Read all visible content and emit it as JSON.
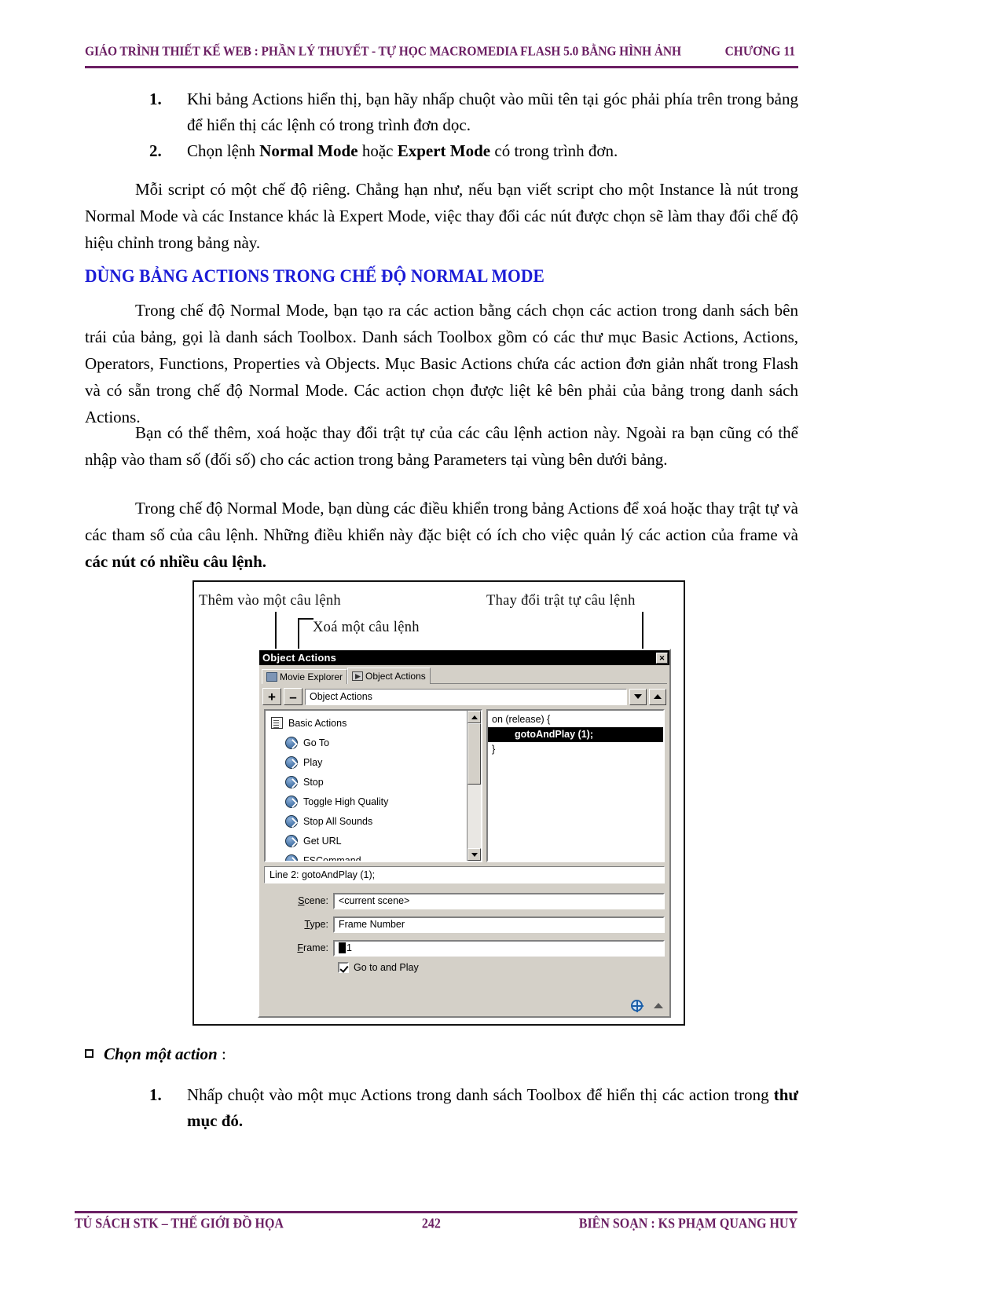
{
  "header": {
    "title": "GIÁO TRÌNH THIẾT KẾ WEB : PHẦN LÝ THUYẾT - TỰ HỌC MACROMEDIA FLASH 5.0 BẰNG HÌNH ẢNH",
    "chapter": "CHƯƠNG 11"
  },
  "list_top": [
    {
      "num": "1.",
      "text": "Khi bảng Actions hiển thị, bạn hãy nhấp chuột vào mũi tên tại góc phải phía trên trong bảng để hiển thị các lệnh có trong trình đơn dọc."
    },
    {
      "num": "2.",
      "text_1": "Chọn lệnh ",
      "bold_1": "Normal Mode",
      "text_2": " hoặc ",
      "bold_2": "Expert Mode",
      "text_3": " có trong trình đơn."
    }
  ],
  "paragraphs": {
    "p1": "Mỗi script có một chế độ riêng. Chẳng hạn như, nếu bạn viết script cho một Instance là nút trong Normal Mode và các Instance khác là Expert Mode, việc thay đổi các nút được chọn sẽ làm thay đổi chế độ hiệu chỉnh trong bảng này.",
    "p2": "Trong chế độ Normal Mode, bạn tạo ra các action bằng cách chọn các action trong danh sách bên trái của bảng, gọi là danh sách Toolbox. Danh sách Toolbox gồm có các thư mục Basic Actions, Actions, Operators, Functions, Properties và Objects. Mục Basic Actions chứa các action đơn giản nhất trong Flash và có sẵn trong chế độ Normal Mode. Các action chọn được liệt kê bên phải của bảng trong danh sách Actions.",
    "p3": "Bạn có thể thêm, xoá hoặc thay đổi trật tự của các câu lệnh action này. Ngoài ra bạn cũng có thể nhập vào tham số (đối số) cho các action trong bảng Parameters tại vùng bên dưới bảng.",
    "p4_a": "Trong chế độ Normal Mode, bạn dùng các điều khiển trong bảng Actions để xoá hoặc thay trật tự và các tham số của câu lệnh. Những điều khiển này đặc biệt có ích cho việc quản lý các action của frame và ",
    "p4_bold": "các nút có nhiều câu lệnh."
  },
  "heading_blue": "DÙNG BẢNG ACTIONS TRONG CHẾ ĐỘ NORMAL MODE",
  "figure": {
    "captions": {
      "add": "Thêm vào một câu lệnh",
      "delete": "Xoá một câu lệnh",
      "reorder": "Thay đổi trật tự câu lệnh"
    },
    "dialog": {
      "title": "Object Actions",
      "close_label": "✕",
      "tabs": [
        {
          "label": "Movie Explorer",
          "icon": "movie-explorer-icon",
          "active": false
        },
        {
          "label": "Object Actions",
          "icon": "flash-action-icon",
          "active": true
        }
      ],
      "toolbar": {
        "add_label": "+",
        "remove_label": "–",
        "combo_value": "Object Actions",
        "down_arrow_icon": "chevron-down-icon",
        "up_arrow_icon": "chevron-up-icon"
      },
      "toolbox": {
        "root": "Basic Actions",
        "items": [
          "Go To",
          "Play",
          "Stop",
          "Toggle High Quality",
          "Stop All Sounds",
          "Get URL",
          "FSCommand"
        ]
      },
      "script": [
        {
          "text": "on (release) {",
          "selected": false,
          "indent": false
        },
        {
          "text": "gotoAndPlay (1);",
          "selected": true,
          "indent": true
        },
        {
          "text": "}",
          "selected": false,
          "indent": false
        }
      ],
      "line_info": "Line 2: gotoAndPlay (1);",
      "parameters": [
        {
          "label": "Scene:",
          "underline": "S",
          "value": "<current scene>"
        },
        {
          "label": "Type:",
          "underline": "T",
          "value": "Frame Number"
        },
        {
          "label": "Frame:",
          "underline": "F",
          "value": "1",
          "caret": true
        }
      ],
      "checkbox": {
        "label": "Go to and Play",
        "checked": true
      },
      "bottom_icons": [
        "globe-icon",
        "resize-grip-icon"
      ]
    }
  },
  "bullet_section": {
    "marker": "square-bullet",
    "label": "Chọn một action",
    "suffix": " :"
  },
  "list_bottom": [
    {
      "num": "1.",
      "text_1": "Nhấp chuột vào một mục Actions trong danh sách Toolbox để hiển thị các action trong ",
      "bold_1": "thư mục đó."
    }
  ],
  "footer": {
    "left": "TỦ SÁCH STK – THẾ GIỚI ĐỒ HỌA",
    "page": "242",
    "right": "BIÊN SOẠN : KS PHẠM QUANG HUY"
  },
  "colors": {
    "header_purple": "#6b1f63",
    "heading_blue": "#1b1bd6",
    "dialog_face": "#d4d0c8"
  }
}
